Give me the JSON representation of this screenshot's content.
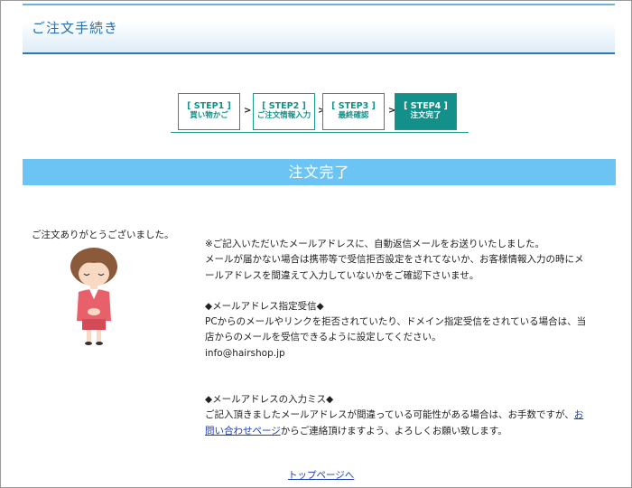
{
  "header": {
    "title": "ご注文手続き"
  },
  "steps": [
    {
      "num": "[ STEP1 ]",
      "label": "買い物かご"
    },
    {
      "num": "[ STEP2 ]",
      "label": "ご注文情報入力"
    },
    {
      "num": "[ STEP3 ]",
      "label": "最終確認"
    },
    {
      "num": "[ STEP4 ]",
      "label": "注文完了"
    }
  ],
  "arrow": ">",
  "banner": {
    "title": "注文完了"
  },
  "thanks": "ご注文ありがとうございました。",
  "body": {
    "p1": "※ご記入いただいたメールアドレスに、自動返信メールをお送りいたしました。",
    "p2": "メールが届かない場合は携帯等で受信拒否設定をされてないか、お客様情報入力の時にメールアドレスを間違えて入力していないかをご確認下さいませ。",
    "heading1": "◆メールアドレス指定受信◆",
    "p3": "PCからのメールやリンクを拒否されていたり、ドメイン指定受信をされている場合は、当店からのメールを受信できるように設定してください。",
    "email": "info@hairshop.jp",
    "heading2": "◆メールアドレスの入力ミス◆",
    "p4_before": "ご記入頂きましたメールアドレスが間違っている可能性がある場合は、お手数ですが、",
    "p4_link": "お問い合わせページ",
    "p4_after": "からご連絡頂けますよう、よろしくお願い致します。"
  },
  "footer": {
    "top_link": "トップページへ"
  },
  "colors": {
    "banner": "#6cc4f4",
    "step_accent": "#139089",
    "header_text": "#2a6fb0",
    "link": "#1a3cbb"
  }
}
